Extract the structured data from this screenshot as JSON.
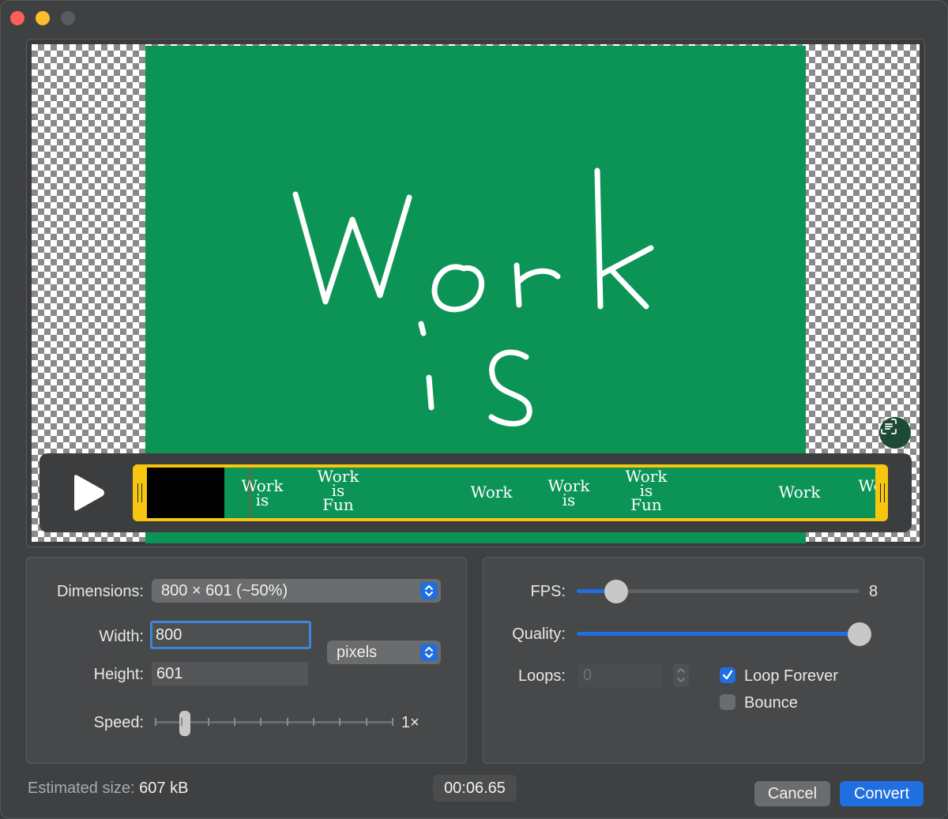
{
  "window": {
    "title": ""
  },
  "preview": {
    "frame_text": [
      "Work",
      "is"
    ],
    "timeline_thumbs": [
      "Work is",
      "Work is Fun",
      "Work",
      "Work is",
      "Work is Fun",
      "Work",
      "Wo"
    ]
  },
  "settings": {
    "dimensions_label": "Dimensions:",
    "dimensions_value": "800 × 601 (~50%)",
    "width_label": "Width:",
    "width_value": "800",
    "height_label": "Height:",
    "height_value": "601",
    "units_value": "pixels",
    "speed_label": "Speed:",
    "speed_value": "1×",
    "speed_level": 0.125
  },
  "output": {
    "fps_label": "FPS:",
    "fps_value": "8",
    "fps_level": 0.14,
    "quality_label": "Quality:",
    "quality_level": 1.0,
    "loops_label": "Loops:",
    "loops_value": "0",
    "loop_forever_label": "Loop Forever",
    "loop_forever_checked": true,
    "bounce_label": "Bounce",
    "bounce_checked": false
  },
  "footer": {
    "estimated_label": "Estimated size:",
    "estimated_value": "607 kB",
    "timecode": "00:06.65",
    "cancel_label": "Cancel",
    "convert_label": "Convert"
  },
  "colors": {
    "accent": "#1f6fe0",
    "frame_green": "#0b9456",
    "timeline_yellow": "#f6c610"
  }
}
